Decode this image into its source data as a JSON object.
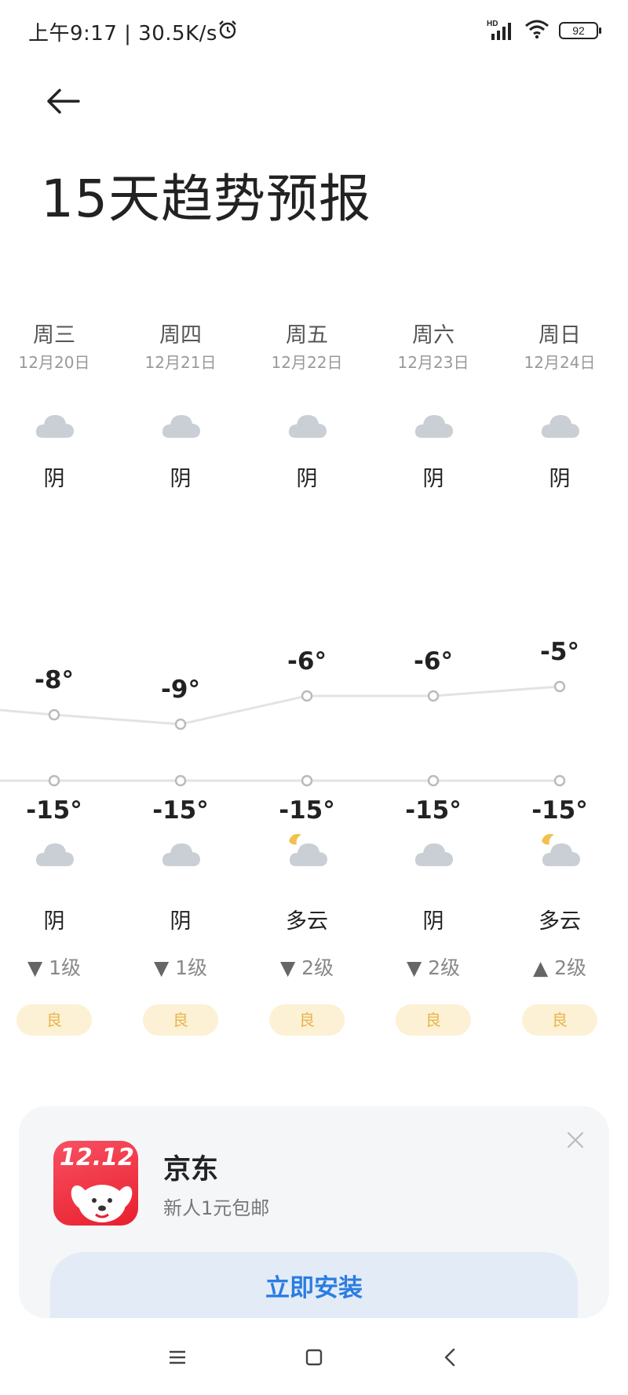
{
  "status_bar": {
    "time_speed": "上午9:17 | 30.5K/s",
    "network": "HD",
    "battery": "92"
  },
  "header": {
    "title": "15天趋势预报"
  },
  "days": [
    {
      "name": "周三",
      "date": "12月20日",
      "day_condition": "阴",
      "day_icon": "cloudy-icon",
      "high": "-8°",
      "low": "-15°",
      "night_icon": "cloudy-icon",
      "night_condition": "阴",
      "wind_dir": "down",
      "wind": "1级",
      "aqi": "良"
    },
    {
      "name": "周四",
      "date": "12月21日",
      "day_condition": "阴",
      "day_icon": "cloudy-icon",
      "high": "-9°",
      "low": "-15°",
      "night_icon": "cloudy-icon",
      "night_condition": "阴",
      "wind_dir": "down",
      "wind": "1级",
      "aqi": "良"
    },
    {
      "name": "周五",
      "date": "12月22日",
      "day_condition": "阴",
      "day_icon": "cloudy-icon",
      "high": "-6°",
      "low": "-15°",
      "night_icon": "partly-cloudy-night-icon",
      "night_condition": "多云",
      "wind_dir": "down",
      "wind": "2级",
      "aqi": "良"
    },
    {
      "name": "周六",
      "date": "12月23日",
      "day_condition": "阴",
      "day_icon": "cloudy-icon",
      "high": "-6°",
      "low": "-15°",
      "night_icon": "cloudy-icon",
      "night_condition": "阴",
      "wind_dir": "down",
      "wind": "2级",
      "aqi": "良"
    },
    {
      "name": "周日",
      "date": "12月24日",
      "day_condition": "阴",
      "day_icon": "cloudy-icon",
      "high": "-5°",
      "low": "-15°",
      "night_icon": "partly-cloudy-night-icon",
      "night_condition": "多云",
      "wind_dir": "up",
      "wind": "2级",
      "aqi": "良"
    }
  ],
  "chart_data": {
    "type": "line",
    "x": [
      "周三",
      "周四",
      "周五",
      "周六",
      "周日"
    ],
    "series": [
      {
        "values": [
          -8,
          -9,
          -6,
          -6,
          -5
        ]
      },
      {
        "values": [
          -15,
          -15,
          -15,
          -15,
          -15
        ]
      }
    ]
  },
  "ad": {
    "logo_text": "12.12",
    "title": "京东",
    "subtitle": "新人1元包邮",
    "button": "立即安装"
  },
  "colors": {
    "aqi_bg": "#fcf1d4",
    "aqi_text": "#e8b54c",
    "cloud": "#c9cfd4",
    "sun": "#f2c04d",
    "install_text": "#2a7de1"
  }
}
